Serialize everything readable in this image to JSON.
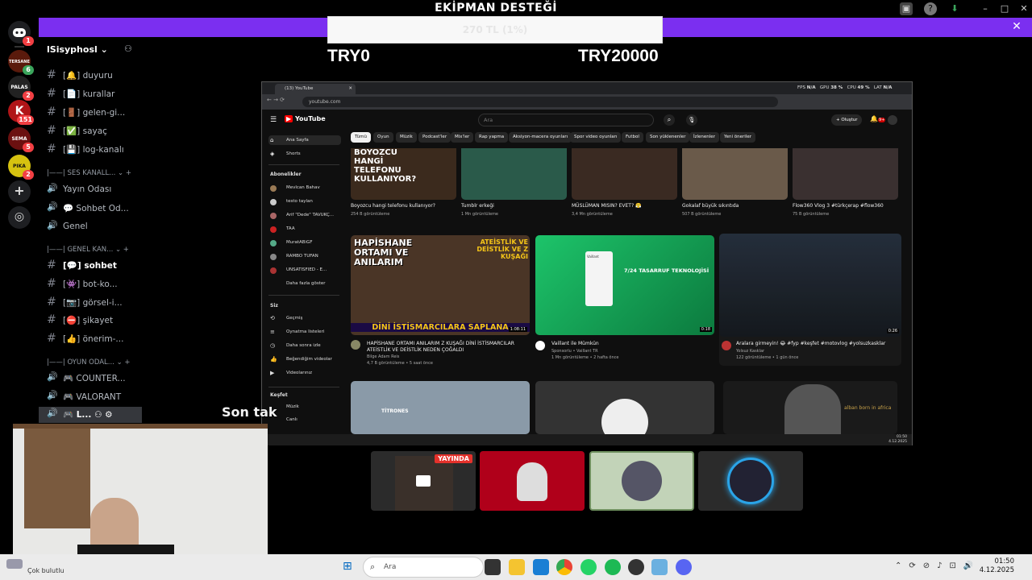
{
  "overlay": {
    "title": "EKİPMAN DESTEĞİ",
    "donation_progress_text": "270 TL (1%)",
    "goal_start": "TRY0",
    "goal_end": "TRY20000",
    "subtitle": "Son tak"
  },
  "discord": {
    "server_name": "lSisyphosl",
    "servers": [
      {
        "name": "TERSANE",
        "color": "#5a1a0c",
        "badge": ""
      },
      {
        "name": "PALAS",
        "color": "#111111",
        "badge": "2"
      },
      {
        "name": "K",
        "color": "#b01518",
        "badge": "151"
      },
      {
        "name": "SEMA",
        "color": "#6b1010",
        "badge": "5"
      },
      {
        "name": "PIKA",
        "color": "#d6c210",
        "badge": "2"
      }
    ],
    "badges": {
      "home": "1",
      "first": "6"
    },
    "channels": [
      {
        "type": "text",
        "emoji": "[🔔]",
        "label": "duyuru"
      },
      {
        "type": "text",
        "emoji": "[📄]",
        "label": "kurallar"
      },
      {
        "type": "text",
        "emoji": "[🚪]",
        "label": "gelen-gi..."
      },
      {
        "type": "text",
        "emoji": "[✅]",
        "label": "sayaç"
      },
      {
        "type": "text",
        "emoji": "[💾]",
        "label": "log-kanalı"
      }
    ],
    "voice_category": "SES KANALL...",
    "voice_channels": [
      {
        "label": "Yayın Odası"
      },
      {
        "label": "Sohbet Od..."
      },
      {
        "label": "Genel"
      }
    ],
    "general_category": "GENEL KAN...",
    "general_channels": [
      {
        "emoji": "[💬]",
        "label": "sohbet",
        "selected": true
      },
      {
        "emoji": "[👾]",
        "label": "bot-ko...",
        "selected": false
      },
      {
        "emoji": "[📷]",
        "label": "görsel-i...",
        "selected": false
      },
      {
        "emoji": "[⛔]",
        "label": "şikayet",
        "selected": false
      },
      {
        "emoji": "[👍]",
        "label": "önerim-...",
        "selected": false
      }
    ],
    "game_category": "OYUN ODAL...",
    "game_channels": [
      {
        "label": "COUNTER..."
      },
      {
        "label": "VALORANT"
      },
      {
        "label": "L..."
      }
    ],
    "live_badge": "YAYINDA"
  },
  "youtube": {
    "tab_title": "(13) YouTube",
    "url": "youtube.com",
    "search_placeholder": "Ara",
    "create_label": "Oluştur",
    "notif_count": "9+",
    "perf": {
      "fps_label": "FPS",
      "fps": "N/A",
      "gpu_label": "GPU",
      "gpu": "38 %",
      "cpu_label": "CPU",
      "cpu": "49 %",
      "lat_label": "LAT",
      "lat": "N/A"
    },
    "chips": [
      "Tümü",
      "Oyun",
      "Müzik",
      "Podcast'ler",
      "Mix'ler",
      "Rap yapma",
      "Aksiyon-macera oyunları",
      "Spor video oyunları",
      "Futbol",
      "Son yüklenenler",
      "İzlenenler",
      "Yeni öneriler"
    ],
    "nav_main": [
      "Ana Sayfa",
      "Shorts"
    ],
    "subs_header": "Abonelikler",
    "subs": [
      "Mevlcan Bahav",
      "testo taylan",
      "Arif \"Dede\" TAVUKÇ...",
      "TAA",
      "MuratABiGF",
      "RAMBO TUFAN",
      "UNSATISFIED - E...",
      "Daha fazla göster"
    ],
    "you_header": "Siz",
    "you_items": [
      "Geçmiş",
      "Oynatma listeleri",
      "Daha sonra izle",
      "Beğendiğim videolar",
      "Videolarınız"
    ],
    "explore_header": "Keşfet",
    "explore_items": [
      "Müzik",
      "Canlı"
    ],
    "row1": [
      {
        "thumb_text": "BOYOZCU HANGİ TELEFONU KULLANIYOR?",
        "title": "Boyozcu hangi telefonu kullanıyor?",
        "meta": "254 B görüntüleme",
        "color": "#3b2a1d"
      },
      {
        "thumb_text": "",
        "title": "Tumblr erkeği",
        "meta": "1 Mn görüntüleme",
        "color": "#2a5a4a"
      },
      {
        "thumb_text": "",
        "title": "MÜSLÜMAN MISIN? EVET? 😤",
        "meta": "3,4 Mn görüntüleme",
        "color": "#3a2a22"
      },
      {
        "thumb_text": "",
        "title": "Gokalaf büyük sıkıntıda",
        "meta": "507 B görüntüleme",
        "color": "#6a5a4a"
      },
      {
        "thumb_text": "",
        "title": "Flow360 Vlog 3 #türkçerap #flow360",
        "meta": "75 B görüntüleme",
        "color": "#3a3030"
      }
    ],
    "row2": [
      {
        "thumb_left": "HAPİSHANE ORTAMI VE ANILARIM",
        "thumb_right": "ATEİSTLİK VE DEİSTLİK VE Z KUŞAĞI",
        "thumb_bottom": "DİNİ İSTİSMARCILARA SAPLANA",
        "duration": "1:08:11",
        "title": "HAPİSHANE ORTAMI ANILARIM Z KUŞAĞI DİNİ İSTİSMARCILAR ATEİSTLİK VE DEİSTLİK NEDEN ÇOĞALDI",
        "channel": "Bilge Adam Reis",
        "meta": "4,7 B görüntüleme • 5 saat önce"
      },
      {
        "thumb_text": "7/24 TASARRUF TEKNOLOJİSİ",
        "brand": "Vaillant",
        "duration": "0:18",
        "title": "Vaillant ile Mümkün",
        "channel": "Sponsorlu • Vaillant TR",
        "meta": "1 Mn görüntüleme • 2 hafta önce"
      },
      {
        "thumb_text": "",
        "duration": "0:26",
        "title": "Aralara girmeyin! 😂 #fyp #keşfet #motovlog #yolsuzkasklar",
        "channel": "Yolsuz Kasklar",
        "meta": "122 görüntüleme • 1 gün önce"
      }
    ],
    "row3": [
      {
        "thumb_text": "TİTRONES"
      },
      {
        "thumb_text": ""
      },
      {
        "thumb_text": "alban born in africa"
      }
    ],
    "inner_clock": {
      "time": "01:50",
      "date": "4.12.2025"
    }
  },
  "taskbar": {
    "weather": "Çok bulutlu",
    "search_placeholder": "Ara",
    "time": "01:50",
    "date": "4.12.2025"
  },
  "colors": {
    "banner": "#7b2ff0",
    "discord_bg": "#000000",
    "yt_red": "#ff0000",
    "live": "#e4312b"
  }
}
